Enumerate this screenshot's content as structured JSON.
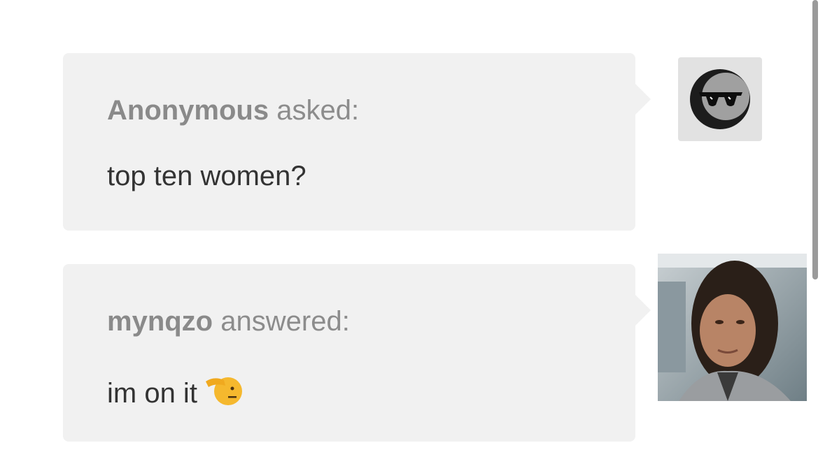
{
  "question": {
    "author": "Anonymous",
    "verb": "asked:",
    "text": "top ten women?",
    "avatar_icon": "sunglasses-crescent-icon"
  },
  "answer": {
    "author": "mynqzo",
    "verb": "answered:",
    "text": "im on it",
    "emoji_icon": "saluting-face-emoji",
    "avatar_icon": "user-photo"
  },
  "colors": {
    "bubble_bg": "#f1f1f1",
    "header_text": "#8c8c8c",
    "body_text": "#333333",
    "avatar_bg": "#e2e2e2"
  }
}
